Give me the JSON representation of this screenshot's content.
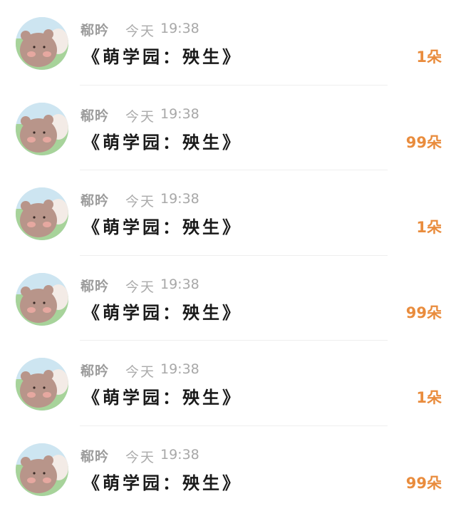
{
  "messages": [
    {
      "sender": "郗昑",
      "date": "今天",
      "time": "19:38",
      "title": "《萌学园：殃生》",
      "gift": "1朵",
      "avatar_icon": "bear-avatar-icon"
    },
    {
      "sender": "郗昑",
      "date": "今天",
      "time": "19:38",
      "title": "《萌学园：殃生》",
      "gift": "99朵",
      "avatar_icon": "bear-avatar-icon"
    },
    {
      "sender": "郗昑",
      "date": "今天",
      "time": "19:38",
      "title": "《萌学园：殃生》",
      "gift": "1朵",
      "avatar_icon": "bear-avatar-icon"
    },
    {
      "sender": "郗昑",
      "date": "今天",
      "time": "19:38",
      "title": "《萌学园：殃生》",
      "gift": "99朵",
      "avatar_icon": "bear-avatar-icon"
    },
    {
      "sender": "郗昑",
      "date": "今天",
      "time": "19:38",
      "title": "《萌学园：殃生》",
      "gift": "1朵",
      "avatar_icon": "bear-avatar-icon"
    },
    {
      "sender": "郗昑",
      "date": "今天",
      "time": "19:38",
      "title": "《萌学园：殃生》",
      "gift": "99朵",
      "avatar_icon": "bear-avatar-icon"
    }
  ],
  "colors": {
    "gift_accent": "#e98c3d",
    "meta_text": "#a8a8a8",
    "title_text": "#1a1a1a"
  }
}
